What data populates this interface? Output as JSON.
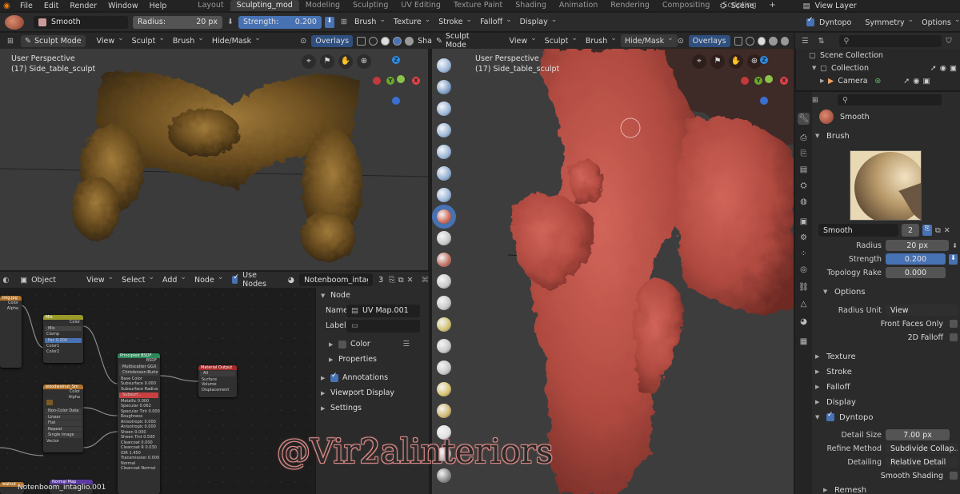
{
  "menubar": {
    "menus": [
      "File",
      "Edit",
      "Render",
      "Window",
      "Help"
    ],
    "workspaces": [
      "Layout",
      "Sculpting_mod",
      "Modeling",
      "Sculpting",
      "UV Editing",
      "Texture Paint",
      "Shading",
      "Animation",
      "Rendering",
      "Compositing",
      "Scripting"
    ],
    "active_workspace": "Sculpting_mod",
    "add_tab": "+",
    "scene": "Scene",
    "view_layer": "View Layer"
  },
  "toolheader": {
    "brush_name": "Smooth",
    "radius_label": "Radius:",
    "radius_value": "20 px",
    "strength_label": "Strength:",
    "strength_value": "0.200",
    "menus": [
      "Brush",
      "Texture",
      "Stroke",
      "Falloff",
      "Display"
    ],
    "dyntopo": "Dyntopo",
    "symmetry": "Symmetry",
    "options": "Options"
  },
  "vp_left": {
    "mode": "Sculpt Mode",
    "menus": [
      "View",
      "Sculpt",
      "Brush",
      "Hide/Mask"
    ],
    "overlays": "Overlays",
    "shading": "Sha",
    "perspective": "User Perspective",
    "object": "(17) Side_table_sculpt"
  },
  "vp_right": {
    "mode": "Sculpt Mode",
    "menus": [
      "View",
      "Sculpt",
      "Brush",
      "Hide/Mask"
    ],
    "overlays": "Overlays",
    "perspective": "User Perspective",
    "object": "(17) Side_table_sculpt"
  },
  "gizmo": {
    "x": "X",
    "y": "Y",
    "z": "Z"
  },
  "node_editor": {
    "object_type": "Object",
    "menus": [
      "View",
      "Select",
      "Add",
      "Node"
    ],
    "use_nodes": "Use Nodes",
    "material": "Notenboom_intaglio",
    "users": "3",
    "bottom_label": "Notenboom_intaglio.001",
    "nodes": {
      "mix": {
        "title": "Mix",
        "lines": [
          "Color",
          "Mix",
          "Clamp",
          "Fac 0.200",
          "Color1",
          "Color2"
        ]
      },
      "image1": {
        "title": "img.jpg",
        "lines": [
          "Color",
          "Alpha"
        ]
      },
      "image2": {
        "title": "woodwalnut_Sm",
        "lines": [
          "Color",
          "Alpha",
          "Non-Color Data",
          "Linear",
          "Flat",
          "Repeat",
          "Single Image",
          "Vector"
        ]
      },
      "bsdf": {
        "title": "Principled BSDF",
        "lines": [
          "BSDF",
          "Multiscatter GGX",
          "Christensen-Burley",
          "Base Color",
          "Subsurface 0.000",
          "Subsurface Radius",
          "Subsurf...",
          "Metallic 0.000",
          "Specular 0.062",
          "Specular Tint 0.000",
          "Roughness",
          "Anisotropic 0.000",
          "Anisotropic 0.000",
          "Sheen 0.000",
          "Sheen Tint 0.500",
          "Clearcoat 0.000",
          "Clearcoat R 0.030",
          "IOR 1.450",
          "Transmission 0.000",
          "Normal",
          "Clearcoat Normal"
        ]
      },
      "output": {
        "title": "Material Output",
        "lines": [
          "All",
          "Surface",
          "Volume",
          "Displacement"
        ]
      },
      "normal": {
        "title": "Normal Map"
      },
      "tex3": {
        "title": "walnut"
      }
    }
  },
  "node_side": {
    "node_panel": "Node",
    "name_label": "Name",
    "name_value": "UV Map.001",
    "label_label": "Label:",
    "color": "Color",
    "properties": "Properties",
    "annotations": "Annotations",
    "viewport_display": "Viewport Display",
    "settings": "Settings"
  },
  "outliner": {
    "root": "Scene Collection",
    "collection": "Collection",
    "camera": "Camera"
  },
  "props": {
    "brush_name": "Smooth",
    "brush_section": "Brush",
    "slot_name": "Smooth",
    "slot_users": "2",
    "radius_label": "Radius",
    "radius_value": "20 px",
    "strength_label": "Strength",
    "strength_value": "0.200",
    "topology_label": "Topology Rake",
    "topology_value": "0.000",
    "options": "Options",
    "radius_unit_label": "Radius Unit",
    "radius_unit_value": "View",
    "front_faces": "Front Faces Only",
    "falloff_2d": "2D Falloff",
    "texture": "Texture",
    "stroke": "Stroke",
    "falloff": "Falloff",
    "display": "Display",
    "dyntopo": "Dyntopo",
    "detail_size_label": "Detail Size",
    "detail_size_value": "7.00 px",
    "refine_label": "Refine Method",
    "refine_value": "Subdivide Collap...",
    "detailing_label": "Detailing",
    "detailing_value": "Relative Detail",
    "smooth_shading": "Smooth Shading",
    "remesh": "Remesh"
  },
  "watermark": "@Vir2alinteriors",
  "colors": {
    "accent": "#4772b3",
    "sculpt": "#b04a40",
    "wood": "#7a5a26"
  }
}
